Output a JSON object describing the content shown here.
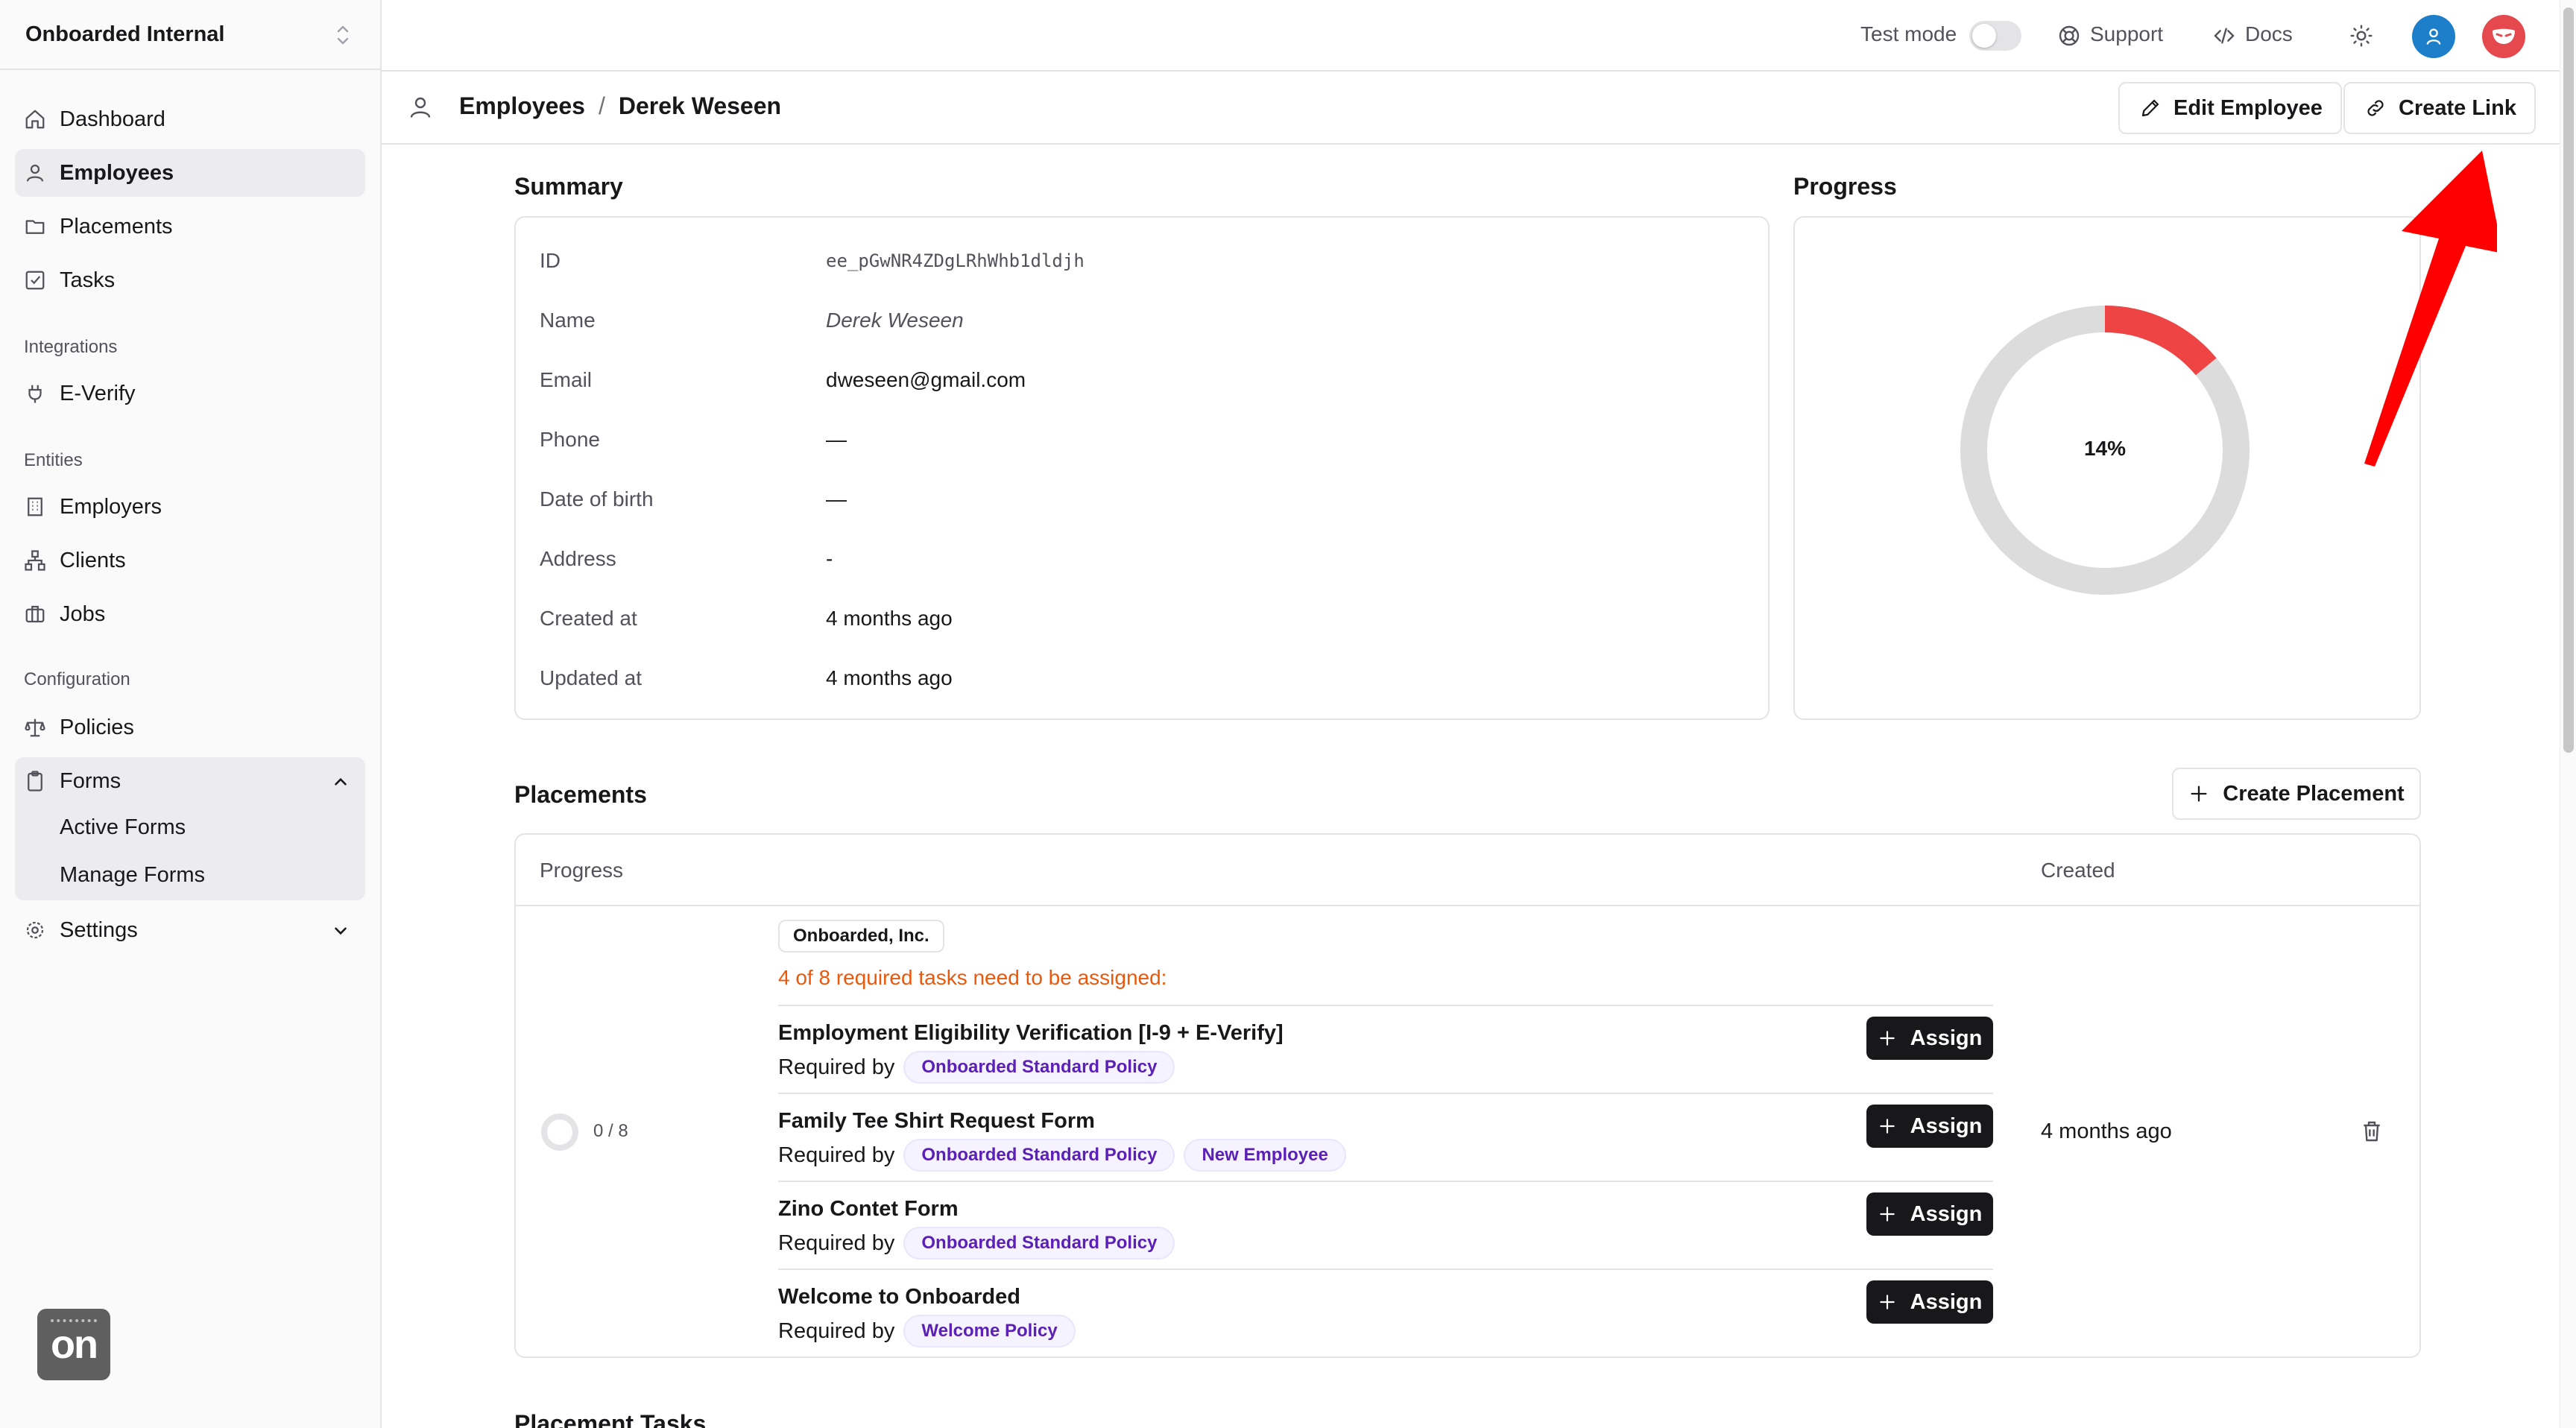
{
  "sidebar": {
    "org_name": "Onboarded Internal",
    "items": [
      {
        "label": "Dashboard",
        "icon": "home-icon"
      },
      {
        "label": "Employees",
        "icon": "user-icon"
      },
      {
        "label": "Placements",
        "icon": "folder-icon"
      },
      {
        "label": "Tasks",
        "icon": "checkbox-icon"
      }
    ],
    "sections": {
      "integrations": "Integrations",
      "entities": "Entities",
      "configuration": "Configuration"
    },
    "integration_items": [
      {
        "label": "E-Verify",
        "icon": "plug-icon"
      }
    ],
    "entity_items": [
      {
        "label": "Employers",
        "icon": "building-icon"
      },
      {
        "label": "Clients",
        "icon": "network-icon"
      },
      {
        "label": "Jobs",
        "icon": "briefcase-icon"
      }
    ],
    "config_items": [
      {
        "label": "Policies",
        "icon": "scale-icon"
      },
      {
        "label": "Forms",
        "icon": "clipboard-icon"
      }
    ],
    "forms_sub": [
      "Active Forms",
      "Manage Forms"
    ],
    "settings": "Settings",
    "logo_text": "on"
  },
  "topbar": {
    "test_mode": "Test mode",
    "support": "Support",
    "docs": "Docs"
  },
  "header": {
    "crumb_parent": "Employees",
    "crumb_separator": "/",
    "crumb_current": "Derek Weseen",
    "edit_button": "Edit Employee",
    "link_button": "Create Link"
  },
  "summary": {
    "title": "Summary",
    "rows": [
      {
        "key": "ID",
        "value": "ee_pGwNR4ZDgLRhWhb1dldjh"
      },
      {
        "key": "Name",
        "value": "Derek Weseen"
      },
      {
        "key": "Email",
        "value": "dweseen@gmail.com"
      },
      {
        "key": "Phone",
        "value": "—"
      },
      {
        "key": "Date of birth",
        "value": "—"
      },
      {
        "key": "Address",
        "value": "-"
      },
      {
        "key": "Created at",
        "value": "4 months ago"
      },
      {
        "key": "Updated at",
        "value": "4 months ago"
      }
    ]
  },
  "progress": {
    "title": "Progress",
    "percent": 14,
    "label": "14%",
    "fill_color": "#ef4444",
    "track_color": "#dcdcdc"
  },
  "placements": {
    "title": "Placements",
    "create_button": "Create Placement",
    "columns": {
      "progress": "Progress",
      "created": "Created"
    },
    "row": {
      "done": 0,
      "progress_text": "0 / 8",
      "employer": "Onboarded, Inc.",
      "warning": "4 of 8 required tasks need to be assigned:",
      "created": "4 months ago",
      "required_by_label": "Required by",
      "assign_label": "Assign",
      "tasks": [
        {
          "title": "Employment Eligibility Verification [I-9 + E-Verify]",
          "policies": [
            "Onboarded Standard Policy"
          ]
        },
        {
          "title": "Family Tee Shirt Request Form",
          "policies": [
            "Onboarded Standard Policy",
            "New Employee"
          ]
        },
        {
          "title": "Zino Contet Form",
          "policies": [
            "Onboarded Standard Policy"
          ]
        },
        {
          "title": "Welcome to Onboarded",
          "policies": [
            "Welcome Policy"
          ]
        }
      ]
    }
  },
  "placement_tasks": {
    "title": "Placement Tasks"
  },
  "colors": {
    "accent_dark": "#18181b",
    "warning": "#ea580c",
    "badge_text": "#5b21b6",
    "avatar_blue": "#1d7fc9",
    "avatar_red": "#e5484d",
    "annotation_arrow": "#ff0000"
  }
}
